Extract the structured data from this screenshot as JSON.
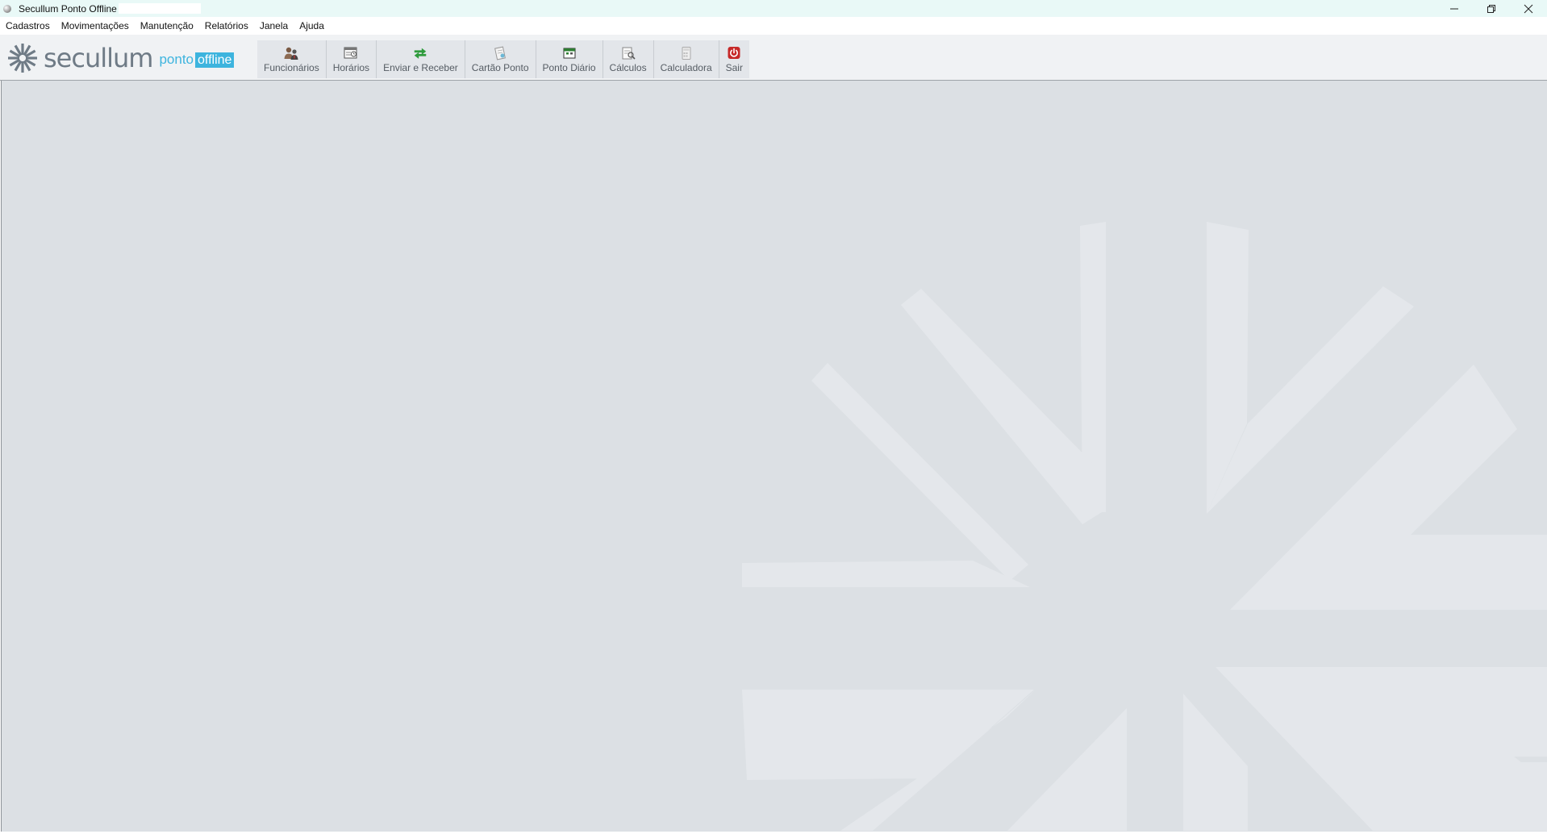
{
  "window": {
    "title": "Secullum Ponto Offline",
    "controls": {
      "minimize": "—",
      "restore": "❐",
      "close": "✕"
    }
  },
  "menu": [
    "Cadastros",
    "Movimentações",
    "Manutenção",
    "Relatórios",
    "Janela",
    "Ajuda"
  ],
  "logo": {
    "word": "secullum",
    "ponto": "ponto",
    "offline": "offline"
  },
  "toolbar": {
    "funcionarios": "Funcionários",
    "horarios": "Horários",
    "enviar_receber": "Enviar e Receber",
    "cartao_ponto": "Cartão Ponto",
    "ponto_diario": "Ponto Diário",
    "calculos": "Cálculos",
    "calculadora": "Calculadora",
    "sair": "Sair"
  },
  "colors": {
    "accent": "#3db4de",
    "workspace": "#dce0e4",
    "exit": "#c62828"
  }
}
